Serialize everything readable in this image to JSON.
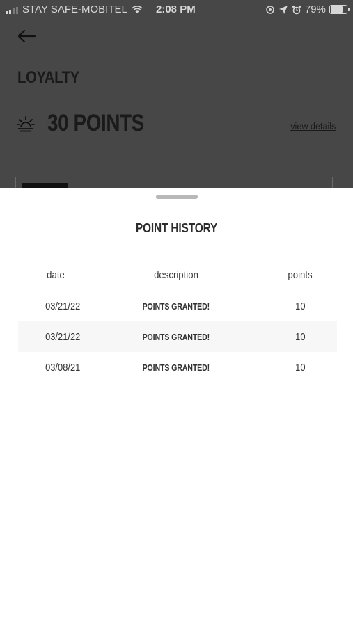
{
  "status_bar": {
    "carrier": "STAY SAFE-MOBITEL",
    "time": "2:08 PM",
    "battery": "79%",
    "battery_level": 0.79
  },
  "background_screen": {
    "title": "LOYALTY",
    "points_total": "30 POINTS",
    "view_details_label": "view details"
  },
  "sheet": {
    "title": "POINT HISTORY",
    "columns": {
      "date": "date",
      "description": "description",
      "points": "points"
    },
    "rows": [
      {
        "date": "03/21/22",
        "description": "POINTS GRANTED!",
        "points": "10"
      },
      {
        "date": "03/21/22",
        "description": "POINTS GRANTED!",
        "points": "10"
      },
      {
        "date": "03/08/21",
        "description": "POINTS GRANTED!",
        "points": "10"
      }
    ]
  }
}
